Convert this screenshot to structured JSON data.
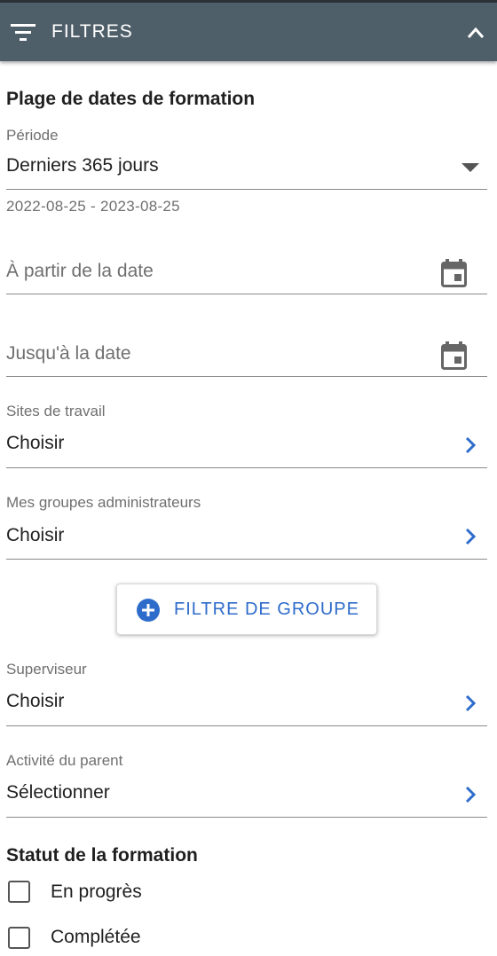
{
  "header": {
    "title": "FILTRES",
    "filter_icon": "filter-list-icon",
    "collapse_icon": "chevron-up-icon",
    "background": "#4f5f69"
  },
  "date_range": {
    "section_title": "Plage de dates de formation",
    "period_label": "Période",
    "period_value": "Derniers 365 jours",
    "range_hint": "2022-08-25 - 2023-08-25",
    "from_placeholder": "À partir de la date",
    "to_placeholder": "Jusqu'à la date"
  },
  "work_sites": {
    "label": "Sites de travail",
    "value": "Choisir"
  },
  "admin_groups": {
    "label": "Mes groupes administrateurs",
    "value": "Choisir"
  },
  "group_filter_button": {
    "label": "FILTRE DE GROUPE",
    "icon": "add-circle-icon",
    "accent": "#2e6ccb"
  },
  "supervisor": {
    "label": "Superviseur",
    "value": "Choisir"
  },
  "parent_activity": {
    "label": "Activité du parent",
    "value": "Sélectionner"
  },
  "status": {
    "section_title": "Statut de la formation",
    "options": [
      {
        "label": "En progrès",
        "checked": false
      },
      {
        "label": "Complétée",
        "checked": false
      }
    ]
  }
}
